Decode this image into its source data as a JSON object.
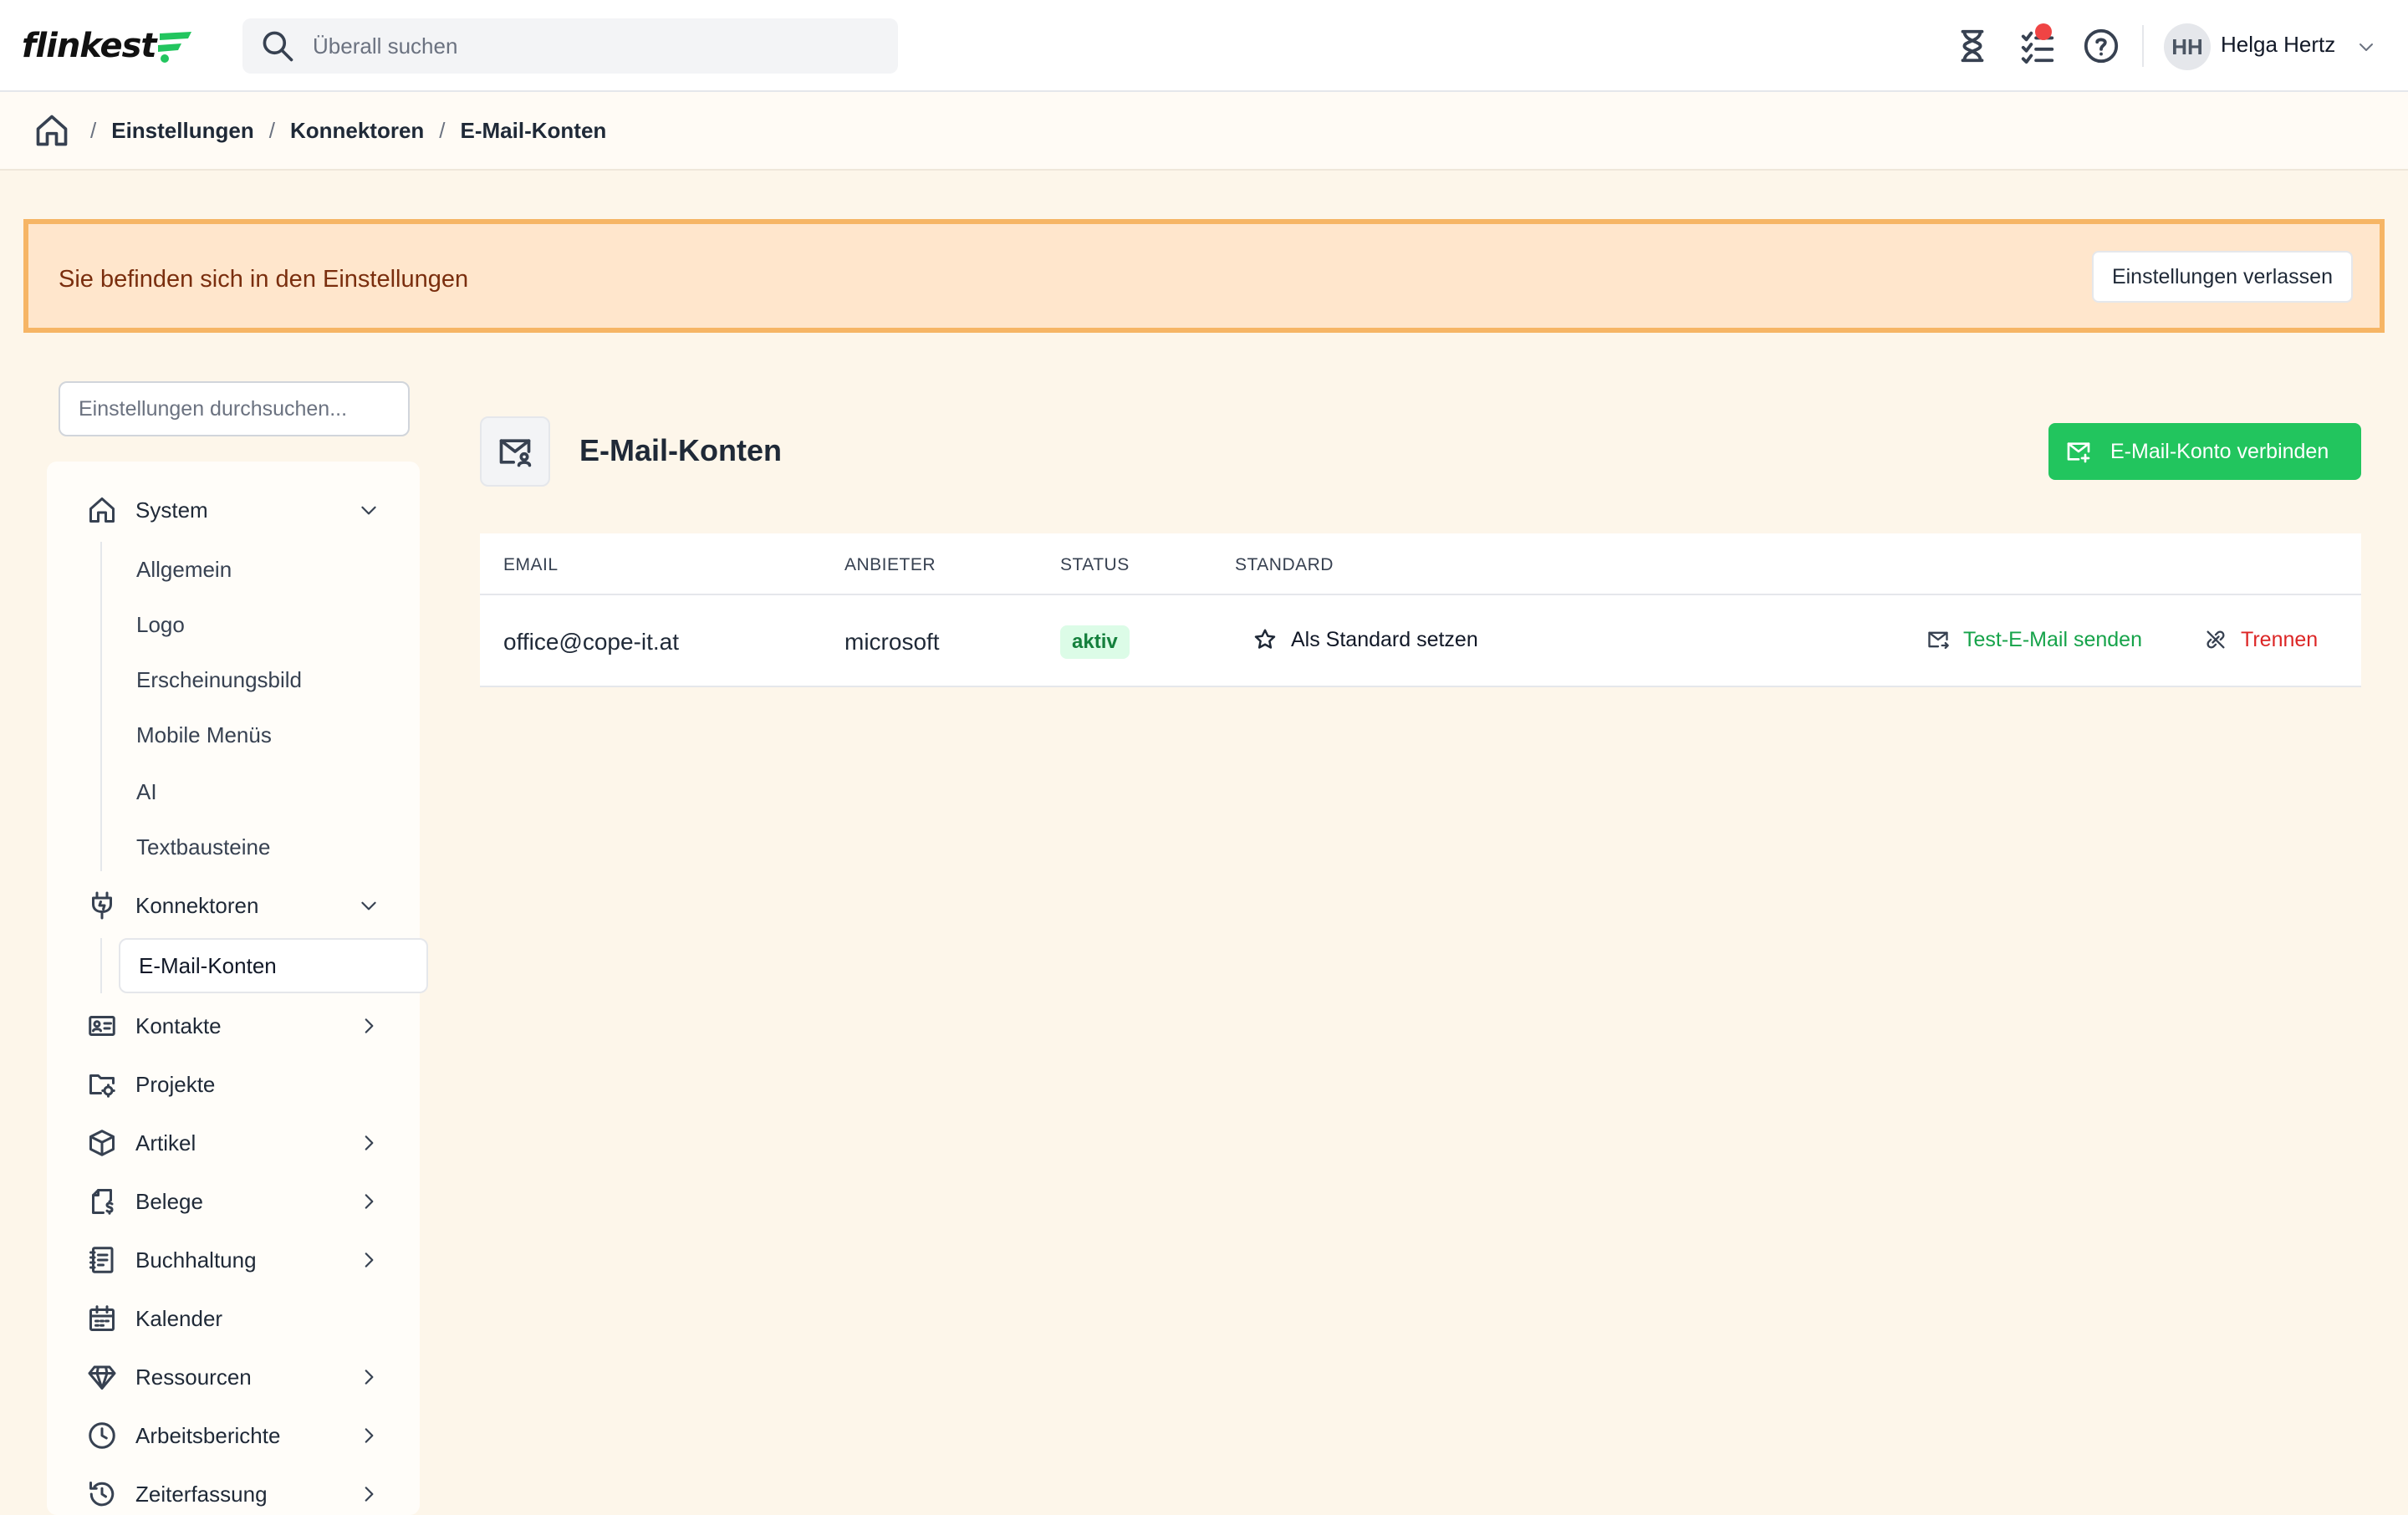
{
  "app": {
    "logo_text": "flinkest"
  },
  "topbar": {
    "search_placeholder": "Überall suchen",
    "icons": [
      "hourglass-icon",
      "checklist-icon",
      "help-icon"
    ],
    "user": {
      "initials": "HH",
      "name": "Helga Hertz"
    }
  },
  "breadcrumb": {
    "items": [
      "Einstellungen",
      "Konnektoren",
      "E-Mail-Konten"
    ]
  },
  "banner": {
    "text": "Sie befinden sich in den Einstellungen",
    "button_label": "Einstellungen verlassen"
  },
  "sidebar": {
    "search_placeholder": "Einstellungen durchsuchen...",
    "items": [
      {
        "label": "System",
        "icon": "home-icon",
        "chevron": "down"
      },
      {
        "label": "Konnektoren",
        "icon": "plug-icon",
        "chevron": "down"
      },
      {
        "label": "Kontakte",
        "icon": "contact-card-icon",
        "chevron": "right"
      },
      {
        "label": "Projekte",
        "icon": "folder-gear-icon",
        "chevron": "none"
      },
      {
        "label": "Artikel",
        "icon": "box-icon",
        "chevron": "right"
      },
      {
        "label": "Belege",
        "icon": "receipt-icon",
        "chevron": "right"
      },
      {
        "label": "Buchhaltung",
        "icon": "ledger-icon",
        "chevron": "right"
      },
      {
        "label": "Kalender",
        "icon": "calendar-icon",
        "chevron": "none"
      },
      {
        "label": "Ressourcen",
        "icon": "diamond-icon",
        "chevron": "right"
      },
      {
        "label": "Arbeitsberichte",
        "icon": "clock-icon",
        "chevron": "right"
      },
      {
        "label": "Zeiterfassung",
        "icon": "history-icon",
        "chevron": "right"
      }
    ],
    "system_sub": [
      "Allgemein",
      "Logo",
      "Erscheinungsbild",
      "Mobile Menüs",
      "AI",
      "Textbausteine"
    ],
    "konnektoren_sub": [
      "E-Mail-Konten"
    ]
  },
  "main": {
    "title": "E-Mail-Konten",
    "primary_button": "E-Mail-Konto verbinden",
    "table": {
      "columns": [
        "EMAIL",
        "ANBIETER",
        "STATUS",
        "STANDARD"
      ],
      "rows": [
        {
          "email": "office@cope-it.at",
          "provider": "microsoft",
          "status": "aktiv",
          "default_action": "Als Standard setzen",
          "test_action": "Test-E-Mail senden",
          "disconnect_action": "Trennen"
        }
      ]
    }
  },
  "colors": {
    "accent_green": "#22c55e",
    "banner_bg": "#ffe6cc",
    "banner_border": "#f6b565",
    "danger": "#dc2626",
    "notification": "#ef4444"
  }
}
